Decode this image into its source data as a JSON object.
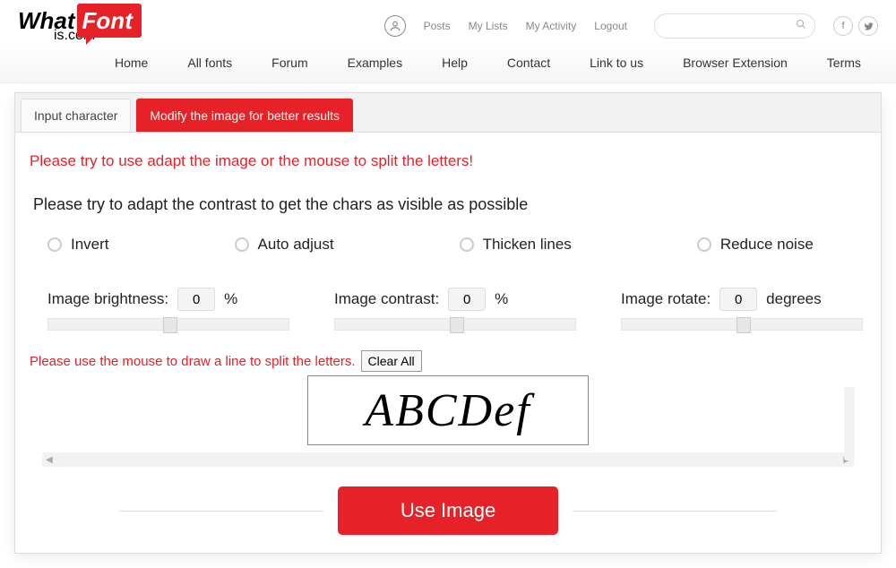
{
  "logo": {
    "part1": "What",
    "part2": "Font",
    "part3": "is.com"
  },
  "top_links": [
    "Posts",
    "My Lists",
    "My Activity",
    "Logout"
  ],
  "main_nav": [
    "Home",
    "All fonts",
    "Forum",
    "Examples",
    "Help",
    "Contact",
    "Link to us",
    "Browser Extension",
    "Terms"
  ],
  "tabs": {
    "inactive": "Input character",
    "active": "Modify the image for better results"
  },
  "messages": {
    "split_warning": "Please try to use adapt the image or the mouse to split the letters!",
    "contrast_instruction": "Please try to adapt the contrast to get the chars as visible as possible",
    "draw_line": "Please use the mouse to draw a line to split the letters."
  },
  "radios": {
    "invert": "Invert",
    "auto_adjust": "Auto adjust",
    "thicken": "Thicken lines",
    "reduce_noise": "Reduce noise"
  },
  "sliders": {
    "brightness": {
      "label": "Image brightness:",
      "value": "0",
      "unit": "%"
    },
    "contrast": {
      "label": "Image contrast:",
      "value": "0",
      "unit": "%"
    },
    "rotate": {
      "label": "Image rotate:",
      "value": "0",
      "unit": "degrees"
    }
  },
  "buttons": {
    "clear_all": "Clear All",
    "use_image": "Use Image"
  },
  "sample_text": "ABCDef",
  "search": {
    "placeholder": ""
  }
}
